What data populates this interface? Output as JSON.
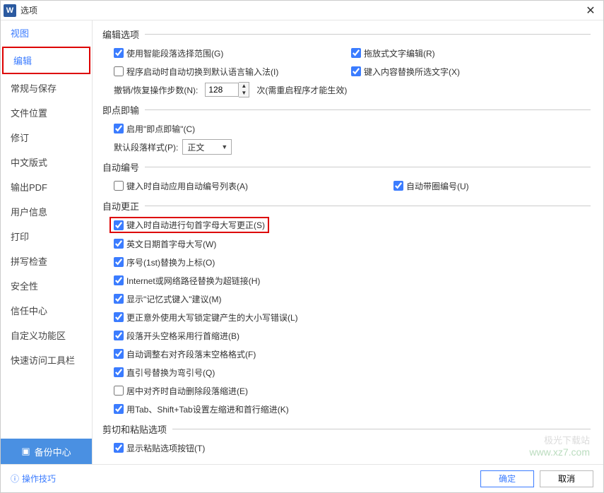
{
  "window": {
    "title": "选项"
  },
  "sidebar": {
    "items": [
      "视图",
      "编辑",
      "常规与保存",
      "文件位置",
      "修订",
      "中文版式",
      "输出PDF",
      "用户信息",
      "打印",
      "拼写检查",
      "安全性",
      "信任中心",
      "自定义功能区",
      "快速访问工具栏"
    ],
    "backup_label": "备份中心"
  },
  "sections": {
    "edit_options": {
      "title": "编辑选项",
      "smart_paragraph": "使用智能段落选择范围(G)",
      "drag_text_edit": "拖放式文字编辑(R)",
      "switch_ime": "程序启动时自动切换到默认语言输入法(I)",
      "replace_selection": "键入内容替换所选文字(X)",
      "undo_steps_label": "撤销/恢复操作步数(N):",
      "undo_steps_value": "128",
      "undo_steps_note": "次(需重启程序才能生效)"
    },
    "click_type": {
      "title": "即点即输",
      "enable": "启用\"即点即输\"(C)",
      "default_para_label": "默认段落样式(P):",
      "default_para_value": "正文"
    },
    "auto_number": {
      "title": "自动编号",
      "apply_list": "键入时自动应用自动编号列表(A)",
      "circle_number": "自动带圈编号(U)"
    },
    "auto_correct": {
      "title": "自动更正",
      "cap_first": "键入时自动进行句首字母大写更正(S)",
      "weekday_cap": "英文日期首字母大写(W)",
      "ordinal": "序号(1st)替换为上标(O)",
      "hyperlink": "Internet或网络路径替换为超链接(H)",
      "memory_typing": "显示\"记忆式键入\"建议(M)",
      "capslock_fix": "更正意外使用大写锁定键产生的大小写错误(L)",
      "first_line_indent": "段落开头空格采用行首缩进(B)",
      "trailing_space": "自动调整右对齐段落末空格格式(F)",
      "smart_quotes": "直引号替换为弯引号(Q)",
      "remove_indent_center": "居中对齐时自动删除段落缩进(E)",
      "tab_indent": "用Tab、Shift+Tab设置左缩进和首行缩进(K)"
    },
    "cut_paste": {
      "title": "剪切和粘贴选项",
      "show_paste_btn": "显示粘贴选项按钮(T)"
    }
  },
  "footer": {
    "tips": "操作技巧",
    "ok": "确定",
    "cancel": "取消"
  },
  "checked": {
    "smart_paragraph": true,
    "drag_text_edit": true,
    "switch_ime": false,
    "replace_selection": true,
    "enable_click": true,
    "apply_list": false,
    "circle_number": true,
    "cap_first": true,
    "weekday_cap": true,
    "ordinal": true,
    "hyperlink": true,
    "memory_typing": true,
    "capslock_fix": true,
    "first_line_indent": true,
    "trailing_space": true,
    "smart_quotes": true,
    "remove_indent_center": false,
    "tab_indent": true,
    "show_paste_btn": true
  },
  "watermark": {
    "line1": "极光下载站",
    "line2": "www.xz7.com"
  }
}
